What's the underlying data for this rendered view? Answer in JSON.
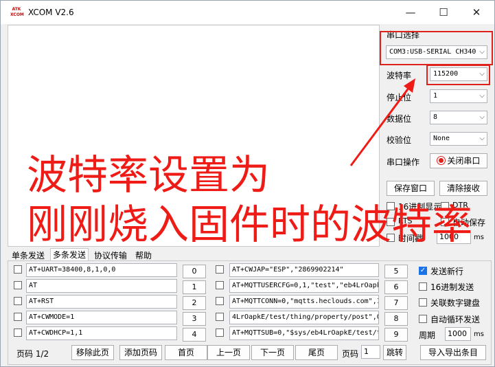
{
  "window": {
    "title": "XCOM V2.6",
    "logo_text": "ATK XCOM",
    "minimize": "—",
    "maximize": "☐",
    "close": "✕"
  },
  "serial": {
    "port_label": "串口选择",
    "port_value": "COM3:USB-SERIAL CH340",
    "baud_label": "波特率",
    "baud_value": "115200",
    "stop_label": "停止位",
    "stop_value": "1",
    "data_label": "数据位",
    "data_value": "8",
    "parity_label": "校验位",
    "parity_value": "None",
    "op_label": "串口操作",
    "op_button": "关闭串口",
    "save_window": "保存窗口",
    "clear_recv": "清除接收",
    "hex_display": "16进制显示",
    "dtr": "DTR",
    "rts": "RTS",
    "auto_save": "自动保存",
    "timestamp": "时间戳",
    "timestamp_value": "1000",
    "ms": "ms"
  },
  "tabs": [
    "单条发送",
    "多条发送",
    "协议传输",
    "帮助"
  ],
  "multi_send": {
    "left_rows": [
      {
        "text": "AT+UART=38400,8,1,0,0",
        "button": "0"
      },
      {
        "text": "AT",
        "button": "1"
      },
      {
        "text": "AT+RST",
        "button": "2"
      },
      {
        "text": "AT+CWMODE=1",
        "button": "3"
      },
      {
        "text": "AT+CWDHCP=1,1",
        "button": "4"
      }
    ],
    "right_rows": [
      {
        "text": "AT+CWJAP=\"ESP\",\"2869902214\"",
        "button": "5"
      },
      {
        "text": "AT+MQTTUSERCFG=0,1,\"test\",\"eb4LrOapk",
        "button": "6"
      },
      {
        "text": "AT+MQTTCONN=0,\"mqtts.heclouds.com\",1",
        "button": "7"
      },
      {
        "text": "4LrOapkE/test/thing/property/post\",0",
        "button": "8"
      },
      {
        "text": "AT+MQTTSUB=0,\"$sys/eb4LrOapkE/test/t",
        "button": "9"
      }
    ],
    "send_newline": "发送新行",
    "hex_send": "16进制发送",
    "link_keyboard": "关联数字键盘",
    "auto_loop": "自动循环发送",
    "period_label": "周期",
    "period_value": "1000",
    "period_unit": "ms"
  },
  "footer": {
    "page_label": "页码 1/2",
    "remove_page": "移除此页",
    "add_page": "添加页码",
    "first_page": "首页",
    "prev_page": "上一页",
    "next_page": "下一页",
    "last_page": "尾页",
    "page_input_label": "页码",
    "page_input_value": "1",
    "jump": "跳转",
    "import_export": "导入导出条目"
  },
  "annotation": {
    "line1": "波特率设置为",
    "line2": "刚刚烧入固件时的波特率",
    "color": "#ee1b16"
  }
}
